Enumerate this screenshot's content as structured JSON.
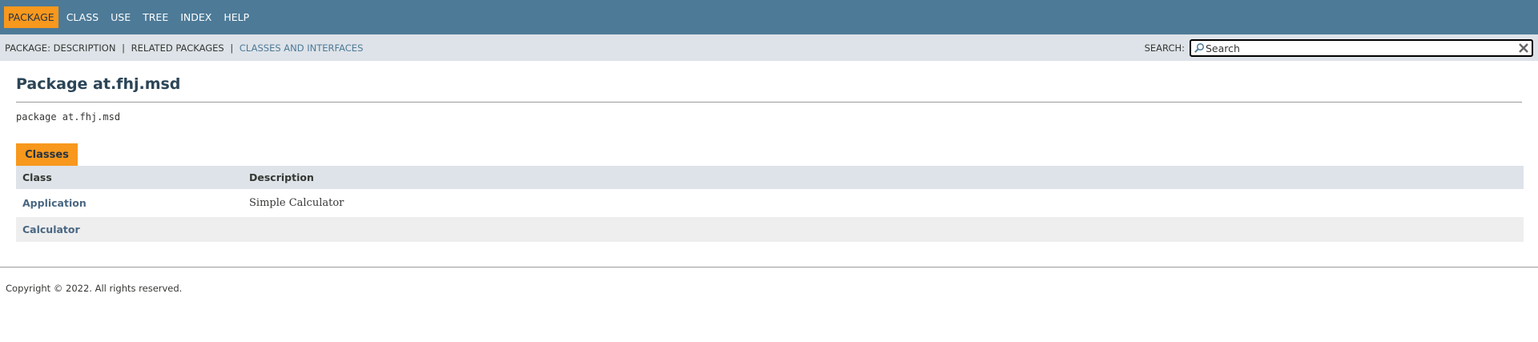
{
  "top_nav": {
    "items": [
      {
        "label": "Package"
      },
      {
        "label": "Class"
      },
      {
        "label": "Use"
      },
      {
        "label": "Tree"
      },
      {
        "label": "Index"
      },
      {
        "label": "Help"
      }
    ],
    "active_index": 0
  },
  "sub_nav": {
    "package_label": "Package:",
    "description_label": "Description",
    "separator": "|",
    "related_packages_label": "Related Packages",
    "classes_and_interfaces_label": "Classes and Interfaces"
  },
  "search": {
    "label": "SEARCH:",
    "placeholder": "Search",
    "value": ""
  },
  "header": {
    "title": "Package at.fhj.msd",
    "signature": "package at.fhj.msd"
  },
  "summary": {
    "tab_label": "Classes",
    "columns": [
      "Class",
      "Description"
    ],
    "rows": [
      {
        "class": "Application",
        "description": "Simple Calculator"
      },
      {
        "class": "Calculator",
        "description": ""
      }
    ]
  },
  "footer": {
    "copyright": "Copyright © 2022. All rights reserved."
  },
  "colors": {
    "top_nav_bg": "#4d7a97",
    "active_tab": "#f8981d",
    "sub_nav_bg": "#dee3e9",
    "link": "#4a6782"
  },
  "icons": {
    "search": "search-icon",
    "reset": "close-icon"
  }
}
